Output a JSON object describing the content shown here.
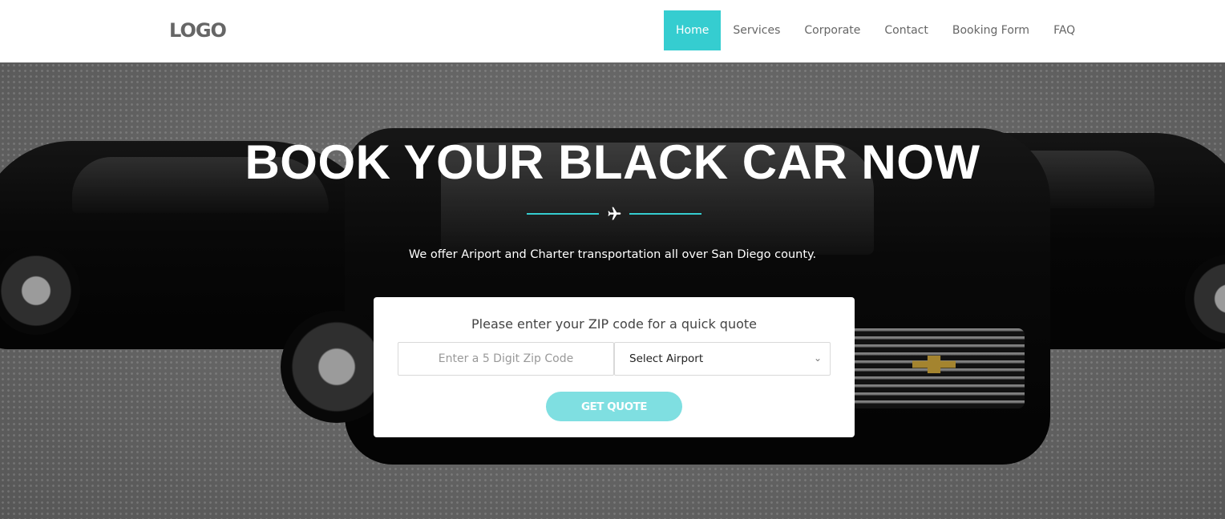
{
  "header": {
    "logo": "LOGO",
    "nav": [
      {
        "label": "Home",
        "active": true
      },
      {
        "label": "Services"
      },
      {
        "label": "Corporate"
      },
      {
        "label": "Contact"
      },
      {
        "label": "Booking Form"
      },
      {
        "label": "FAQ"
      }
    ]
  },
  "hero": {
    "title": "BOOK YOUR BLACK CAR NOW",
    "subtitle": "We offer Ariport and Charter transportation all over San Diego county.",
    "divider_icon": "plane-icon"
  },
  "quote": {
    "title": "Please enter your ZIP code for a quick quote",
    "zip_placeholder": "Enter a 5 Digit Zip Code",
    "airport_selected": "Select Airport",
    "button": "GET QUOTE"
  },
  "colors": {
    "accent": "#35cdd0",
    "button": "#7fdfe1"
  }
}
